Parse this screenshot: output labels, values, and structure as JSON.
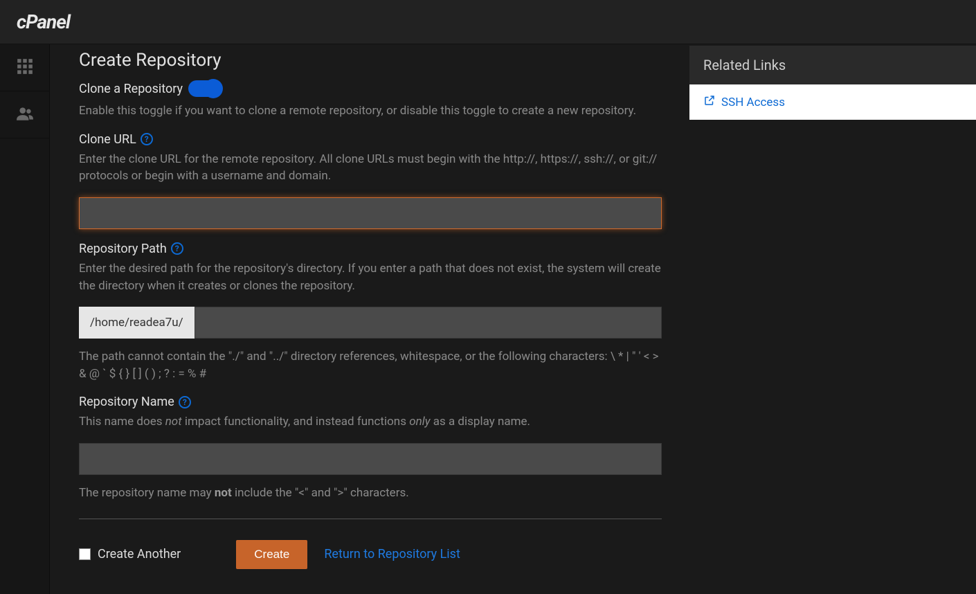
{
  "header": {
    "logo": "cPanel"
  },
  "sidebar": {
    "items": [
      {
        "name": "apps-icon"
      },
      {
        "name": "users-icon"
      }
    ]
  },
  "page": {
    "title": "Create Repository",
    "clone_toggle": {
      "label": "Clone a Repository",
      "help": "Enable this toggle if you want to clone a remote repository, or disable this toggle to create a new repository."
    },
    "clone_url": {
      "label": "Clone URL",
      "help": "Enter the clone URL for the remote repository. All clone URLs must begin with the http://, https://, ssh://, or git:// protocols or begin with a username and domain.",
      "value": ""
    },
    "repo_path": {
      "label": "Repository Path",
      "help": "Enter the desired path for the repository's directory. If you enter a path that does not exist, the system will create the directory when it creates or clones the repository.",
      "prefix": "/home/readea7u/",
      "value": "",
      "help2": "The path cannot contain the \"./\" and \"../\" directory references, whitespace, or the following characters: \\ * | \" ' < > & @ ` $ { } [ ] ( ) ; ? : = % #"
    },
    "repo_name": {
      "label": "Repository Name",
      "help_pre": "This name does ",
      "help_em1": "not",
      "help_mid": " impact functionality, and instead functions ",
      "help_em2": "only",
      "help_post": " as a display name.",
      "value": "",
      "help2_pre": "The repository name may ",
      "help2_strong": "not",
      "help2_post": " include the \"<\" and \">\" characters."
    },
    "actions": {
      "create_another": "Create Another",
      "create": "Create",
      "return": "Return to Repository List"
    }
  },
  "related": {
    "title": "Related Links",
    "ssh": "SSH Access"
  }
}
